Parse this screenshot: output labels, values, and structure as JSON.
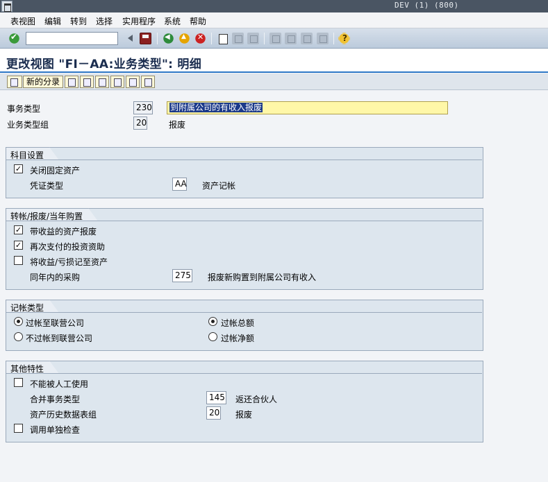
{
  "window": {
    "system_info": "DEV (1) (800)"
  },
  "menu": [
    "表视图",
    "编辑",
    "转到",
    "选择",
    "实用程序",
    "系统",
    "帮助"
  ],
  "page_title": "更改视图 \"FI－AA:业务类型\": 明细",
  "app_toolbar": {
    "new_entries_label": "新的分录"
  },
  "header": {
    "trans_type_label": "事务类型",
    "trans_type_value": "230",
    "trans_type_desc": "到附属公司的有收入报废",
    "group_label": "业务类型组",
    "group_value": "20",
    "group_desc": "报废"
  },
  "group_account": {
    "title": "科目设置",
    "deactivate_asset_label": "关闭固定资产",
    "deactivate_asset_checked": true,
    "doc_type_label": "凭证类型",
    "doc_type_value": "AA",
    "doc_type_desc": "资产记帐"
  },
  "group_transfer": {
    "title": "转帐/报废/当年购置",
    "retirement_with_revenue_label": "带收益的资产报废",
    "retirement_with_revenue_checked": true,
    "repay_invest_label": "再次支付的投资资助",
    "repay_invest_checked": true,
    "post_gain_loss_label": "将收益/亏损记至资产",
    "post_gain_loss_checked": false,
    "same_year_acq_label": "同年内的采购",
    "same_year_acq_value": "275",
    "same_year_acq_desc": "报废新购置到附属公司有收入"
  },
  "group_posting": {
    "title": "记帐类型",
    "to_affiliated_label": "过帐至联营公司",
    "to_affiliated_selected": true,
    "not_to_affiliated_label": "不过帐到联营公司",
    "not_to_affiliated_selected": false,
    "gross_label": "过帐总额",
    "gross_selected": true,
    "net_label": "过帐净额",
    "net_selected": false
  },
  "group_other": {
    "title": "其他特性",
    "no_manual_label": "不能被人工使用",
    "no_manual_checked": false,
    "consol_trans_label": "合并事务类型",
    "consol_trans_value": "145",
    "consol_trans_desc": "返还合伙人",
    "asset_hist_label": "资产历史数据表组",
    "asset_hist_value": "20",
    "asset_hist_desc": "报废",
    "call_indiv_check_label": "调用单独检查",
    "call_indiv_check_checked": false
  },
  "colors": {
    "title_bar": "#4a5563",
    "toolbar": "#c8d4e2",
    "accent_line": "#2e78c6",
    "group_bg": "#dde6ee",
    "highlight_field": "#fff7a8"
  }
}
